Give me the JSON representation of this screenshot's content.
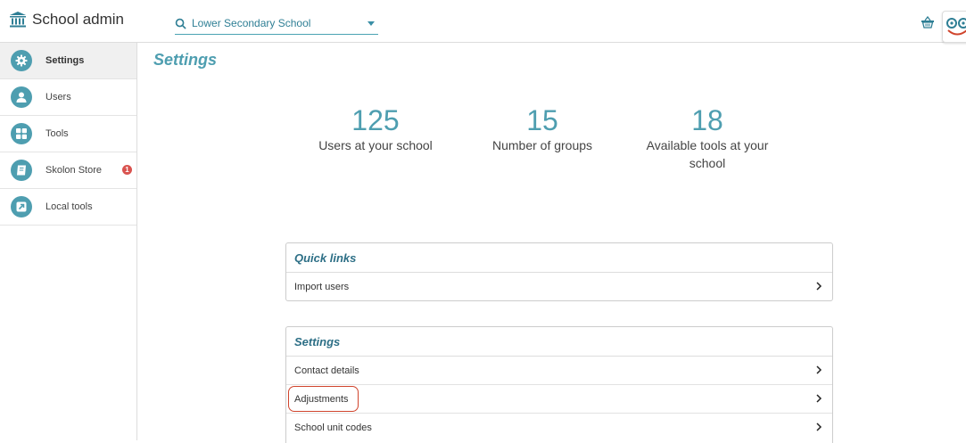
{
  "header": {
    "app_title": "School admin",
    "school_select": {
      "value": "Lower Secondary School"
    }
  },
  "sidebar": {
    "items": [
      {
        "label": "Settings",
        "icon": "gear-icon",
        "active": true
      },
      {
        "label": "Users",
        "icon": "user-icon"
      },
      {
        "label": "Tools",
        "icon": "grid-icon"
      },
      {
        "label": "Skolon Store",
        "icon": "book-icon",
        "badge": "1"
      },
      {
        "label": "Local tools",
        "icon": "external-link-icon"
      }
    ]
  },
  "main": {
    "title": "Settings",
    "stats": [
      {
        "value": "125",
        "label": "Users at your school"
      },
      {
        "value": "15",
        "label": "Number of groups"
      },
      {
        "value": "18",
        "label": "Available tools at your school"
      }
    ],
    "quick_links": {
      "title": "Quick links",
      "items": [
        {
          "label": "Import users"
        }
      ]
    },
    "settings_card": {
      "title": "Settings",
      "items": [
        {
          "label": "Contact details"
        },
        {
          "label": "Adjustments",
          "highlighted": true
        },
        {
          "label": "School unit codes"
        }
      ]
    }
  },
  "colors": {
    "accent": "#4e9eb0",
    "highlight": "#d0442c",
    "badge": "#d9534f"
  }
}
